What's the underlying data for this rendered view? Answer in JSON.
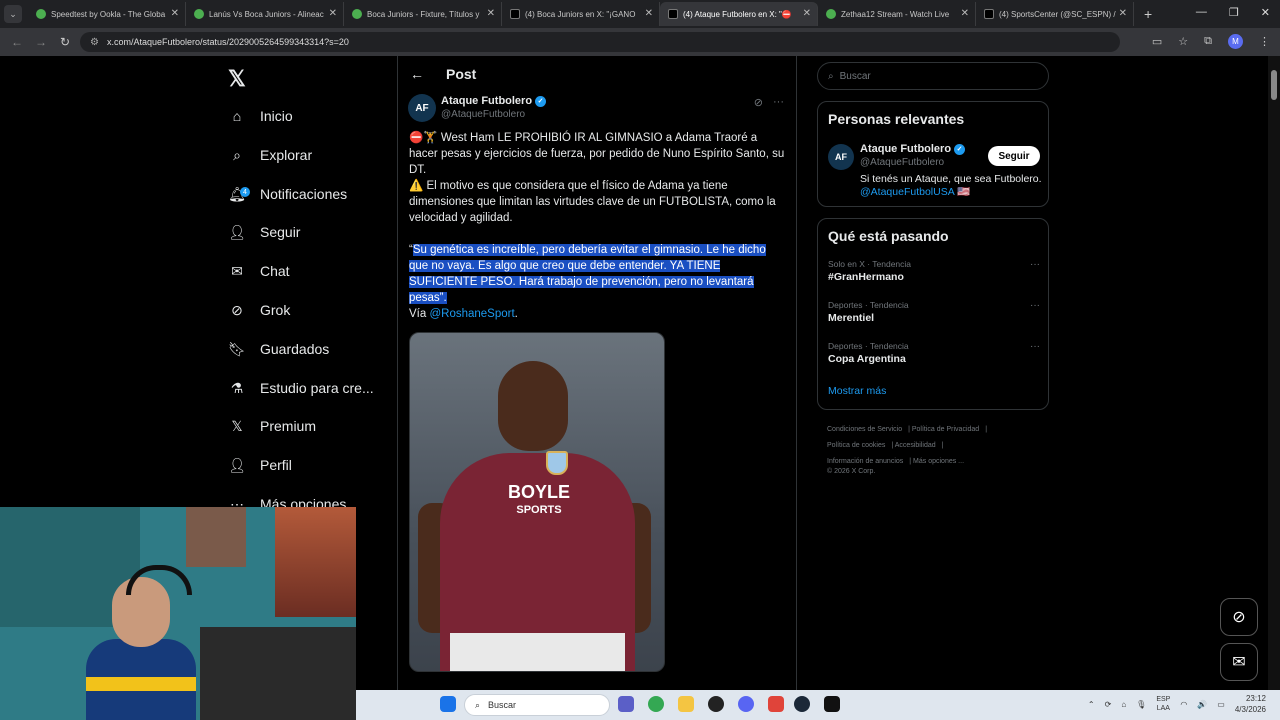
{
  "browser": {
    "tabs": [
      {
        "title": "Speedtest by Ookla - The Globa",
        "active": false
      },
      {
        "title": "Lanús Vs Boca Juniors - Alineac",
        "active": false
      },
      {
        "title": "Boca Juniors - Fixture, Títulos y",
        "active": false
      },
      {
        "title": "(4) Boca Juniors en X: \"¡GANO",
        "active": false
      },
      {
        "title": "(4) Ataque Futbolero en X: \"⛔",
        "active": true
      },
      {
        "title": "Zethaa12 Stream - Watch Live",
        "active": false
      },
      {
        "title": "(4) SportsCenter (@SC_ESPN) /",
        "active": false
      }
    ],
    "url": "x.com/AtaqueFutbolero/status/2029005264599343314?s=20",
    "profile_initial": "M"
  },
  "nav": {
    "items": [
      {
        "label": "Inicio",
        "icon": "home-icon"
      },
      {
        "label": "Explorar",
        "icon": "search-icon"
      },
      {
        "label": "Notificaciones",
        "icon": "bell-icon",
        "badge": "4"
      },
      {
        "label": "Seguir",
        "icon": "add-user-icon"
      },
      {
        "label": "Chat",
        "icon": "mail-icon"
      },
      {
        "label": "Grok",
        "icon": "grok-icon"
      },
      {
        "label": "Guardados",
        "icon": "bookmark-icon"
      },
      {
        "label": "Estudio para cre...",
        "icon": "flask-icon"
      },
      {
        "label": "Premium",
        "icon": "x-icon"
      },
      {
        "label": "Perfil",
        "icon": "person-icon"
      },
      {
        "label": "Más opciones",
        "icon": "more-icon"
      }
    ]
  },
  "post": {
    "header": "Post",
    "author_name": "Ataque Futbolero",
    "author_handle": "@AtaqueFutbolero",
    "para1": "⛔🏋 West Ham LE PROHIBIÓ IR AL GIMNASIO a Adama Traoré a hacer pesas y ejercicios de fuerza, por pedido de Nuno Espírito Santo, su DT.",
    "para2": "⚠️ El motivo es que considera que el físico de Adama ya tiene dimensiones que limitan las virtudes clave de un FUTBOLISTA, como la velocidad y agilidad.",
    "quote_open": "“",
    "quote": "Su genética es increíble, pero debería evitar el gimnasio. Le he dicho que no vaya. Es algo que creo que debe entender. YA TIENE SUFICIENTE PESO. Hará trabajo de prevención, pero no levantará pesas”.",
    "via_prefix": "Vía ",
    "via_link": "@RoshaneSport",
    "via_suffix": ".",
    "image_sponsor": "BOYLE",
    "image_sponsor2": "SPORTS"
  },
  "sidebar": {
    "search_placeholder": "Buscar",
    "relevant_title": "Personas relevantes",
    "relevant_name": "Ataque Futbolero",
    "relevant_handle": "@AtaqueFutbolero",
    "follow_label": "Seguir",
    "bio": "Si tenés un Ataque, que sea Futbolero.",
    "bio_link": "@AtaqueFutbolUSA 🇺🇸",
    "trending_title": "Qué está pasando",
    "trends": [
      {
        "category": "Solo en X · Tendencia",
        "name": "#GranHermano"
      },
      {
        "category": "Deportes · Tendencia",
        "name": "Merentiel"
      },
      {
        "category": "Deportes · Tendencia",
        "name": "Copa Argentina"
      }
    ],
    "show_more": "Mostrar más",
    "footer": [
      "Condiciones de Servicio",
      "Política de Privacidad",
      "Política de cookies",
      "Accesibilidad",
      "Información de anuncios",
      "Más opciones ...",
      "© 2026 X Corp."
    ]
  },
  "taskbar": {
    "search_placeholder": "Buscar",
    "lang_line1": "ESP",
    "lang_line2": "LAA",
    "time": "23:12",
    "date": "4/3/2026"
  }
}
